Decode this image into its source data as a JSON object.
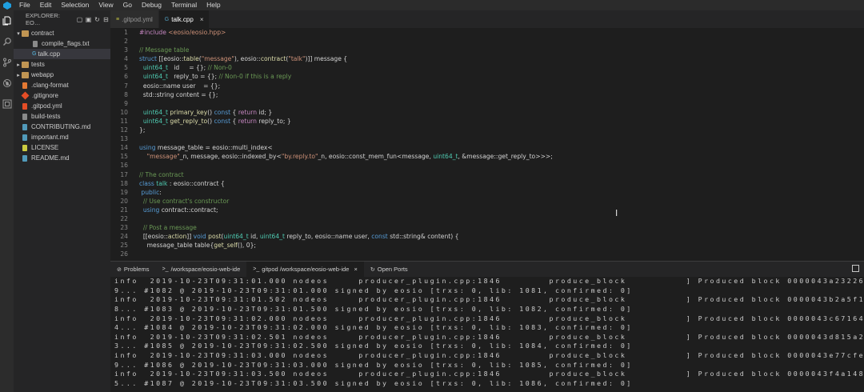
{
  "menubar": {
    "items": [
      "File",
      "Edit",
      "Selection",
      "View",
      "Go",
      "Debug",
      "Terminal",
      "Help"
    ]
  },
  "activity_bar": {
    "icons": [
      "files-icon",
      "search-icon",
      "source-control-icon",
      "debug-icon",
      "extensions-icon"
    ]
  },
  "sidebar": {
    "title": "EXPLORER: EO…",
    "tree": [
      {
        "label": "contract",
        "kind": "folder",
        "open": true,
        "level": 0
      },
      {
        "label": "compile_flags.txt",
        "kind": "file",
        "level": 1
      },
      {
        "label": "talk.cpp",
        "kind": "cpp",
        "level": 1,
        "selected": true
      },
      {
        "label": "tests",
        "kind": "folder",
        "open": false,
        "level": 0
      },
      {
        "label": "webapp",
        "kind": "folder",
        "open": false,
        "level": 0
      },
      {
        "label": ".clang-format",
        "kind": "fmt",
        "level": 0
      },
      {
        "label": ".gitignore",
        "kind": "git",
        "level": 0
      },
      {
        "label": ".gitpod.yml",
        "kind": "yml",
        "level": 0
      },
      {
        "label": "build-tests",
        "kind": "file",
        "level": 0
      },
      {
        "label": "CONTRIBUTING.md",
        "kind": "md",
        "level": 0
      },
      {
        "label": "important.md",
        "kind": "md",
        "level": 0
      },
      {
        "label": "LICENSE",
        "kind": "lic",
        "level": 0
      },
      {
        "label": "README.md",
        "kind": "md",
        "level": 0
      }
    ]
  },
  "tabs": [
    {
      "label": ".gitpod.yml",
      "active": false,
      "icon_text": "≡"
    },
    {
      "label": "talk.cpp",
      "active": true,
      "icon_text": "G"
    }
  ],
  "editor": {
    "lines": [
      {
        "n": "1",
        "tokens": [
          [
            "pp",
            "#include"
          ],
          [
            "str",
            " <eosio/eosio.hpp>"
          ]
        ]
      },
      {
        "n": "2",
        "tokens": []
      },
      {
        "n": "3",
        "tokens": [
          [
            "cm",
            "// Message table"
          ]
        ]
      },
      {
        "n": "4",
        "tokens": [
          [
            "kw",
            "struct"
          ],
          [
            "code",
            " [["
          ],
          [
            "ns",
            "eosio"
          ],
          [
            "code",
            "::"
          ],
          [
            "fn",
            "table"
          ],
          [
            "code",
            "("
          ],
          [
            "str",
            "\"message\""
          ],
          [
            "code",
            "), "
          ],
          [
            "ns",
            "eosio"
          ],
          [
            "code",
            "::"
          ],
          [
            "fn",
            "contract"
          ],
          [
            "code",
            "("
          ],
          [
            "str",
            "\"talk\""
          ],
          [
            "code",
            ")]] message {"
          ]
        ]
      },
      {
        "n": "5",
        "tokens": [
          [
            "code",
            "  "
          ],
          [
            "ty",
            "uint64_t"
          ],
          [
            "code",
            "   id     = {}; "
          ],
          [
            "cm",
            "// Non-0"
          ]
        ]
      },
      {
        "n": "6",
        "tokens": [
          [
            "code",
            "  "
          ],
          [
            "ty",
            "uint64_t"
          ],
          [
            "code",
            "   reply_to = {}; "
          ],
          [
            "cm",
            "// Non-0 if this is a reply"
          ]
        ]
      },
      {
        "n": "7",
        "tokens": [
          [
            "code",
            "  eosio::name user    = {};"
          ]
        ]
      },
      {
        "n": "8",
        "tokens": [
          [
            "code",
            "  std::string content = {};"
          ]
        ]
      },
      {
        "n": "9",
        "tokens": []
      },
      {
        "n": "10",
        "tokens": [
          [
            "code",
            "  "
          ],
          [
            "ty",
            "uint64_t"
          ],
          [
            "code",
            " "
          ],
          [
            "fn",
            "primary_key"
          ],
          [
            "code",
            "() "
          ],
          [
            "kw",
            "const"
          ],
          [
            "code",
            " { "
          ],
          [
            "pp",
            "return"
          ],
          [
            "code",
            " id; }"
          ]
        ]
      },
      {
        "n": "11",
        "tokens": [
          [
            "code",
            "  "
          ],
          [
            "ty",
            "uint64_t"
          ],
          [
            "code",
            " "
          ],
          [
            "fn",
            "get_reply_to"
          ],
          [
            "code",
            "() "
          ],
          [
            "kw",
            "const"
          ],
          [
            "code",
            " { "
          ],
          [
            "pp",
            "return"
          ],
          [
            "code",
            " reply_to; }"
          ]
        ]
      },
      {
        "n": "12",
        "tokens": [
          [
            "code",
            "};"
          ]
        ]
      },
      {
        "n": "13",
        "tokens": []
      },
      {
        "n": "14",
        "tokens": [
          [
            "kw",
            "using"
          ],
          [
            "code",
            " message_table = eosio::multi_index<"
          ]
        ]
      },
      {
        "n": "15",
        "tokens": [
          [
            "code",
            "    "
          ],
          [
            "str",
            "\"message\""
          ],
          [
            "code",
            "_n, message, eosio::indexed_by<"
          ],
          [
            "str",
            "\"by.reply.to\""
          ],
          [
            "code",
            "_n, eosio::const_mem_fun<message, "
          ],
          [
            "ty",
            "uint64_t"
          ],
          [
            "code",
            ", &message::get_reply_to>>>;"
          ]
        ]
      },
      {
        "n": "16",
        "tokens": []
      },
      {
        "n": "17",
        "tokens": [
          [
            "cm",
            "// The contract"
          ]
        ]
      },
      {
        "n": "18",
        "tokens": [
          [
            "kw",
            "class"
          ],
          [
            "code",
            " "
          ],
          [
            "ty",
            "talk"
          ],
          [
            "code",
            " : eosio::contract {"
          ]
        ]
      },
      {
        "n": "19",
        "tokens": [
          [
            "code",
            " "
          ],
          [
            "kw",
            "public"
          ],
          [
            "code",
            ":"
          ]
        ]
      },
      {
        "n": "20",
        "tokens": [
          [
            "code",
            "  "
          ],
          [
            "cm",
            "// Use contract's constructor"
          ]
        ]
      },
      {
        "n": "21",
        "tokens": [
          [
            "code",
            "  "
          ],
          [
            "kw",
            "using"
          ],
          [
            "code",
            " contract::contract;"
          ]
        ]
      },
      {
        "n": "22",
        "tokens": []
      },
      {
        "n": "23",
        "tokens": [
          [
            "code",
            "  "
          ],
          [
            "cm",
            "// Post a message"
          ]
        ]
      },
      {
        "n": "24",
        "tokens": [
          [
            "code",
            "  [["
          ],
          [
            "ns",
            "eosio"
          ],
          [
            "code",
            "::"
          ],
          [
            "fn",
            "action"
          ],
          [
            "code",
            "]] "
          ],
          [
            "kw",
            "void"
          ],
          [
            "code",
            " "
          ],
          [
            "fn",
            "post"
          ],
          [
            "code",
            "("
          ],
          [
            "ty",
            "uint64_t"
          ],
          [
            "code",
            " id, "
          ],
          [
            "ty",
            "uint64_t"
          ],
          [
            "code",
            " reply_to, eosio::name user, "
          ],
          [
            "kw",
            "const"
          ],
          [
            "code",
            " std::string& content) {"
          ]
        ]
      },
      {
        "n": "25",
        "tokens": [
          [
            "code",
            "    message_table table{"
          ],
          [
            "fn",
            "get_self"
          ],
          [
            "code",
            "(), 0};"
          ]
        ]
      },
      {
        "n": "26",
        "tokens": []
      }
    ]
  },
  "panel": {
    "tabs": [
      {
        "label": "Problems",
        "icon": "⊘"
      },
      {
        "label": "/workspace/eosio-web-ide",
        "icon": ">_"
      },
      {
        "label": "gitpod /workspace/eosio-web-ide",
        "icon": ">_",
        "active": true,
        "closable": true
      },
      {
        "label": "Open Ports",
        "icon": "↻"
      }
    ],
    "terminal_lines": [
      "info  2019-10-23T09:31:01.000 nodeos     producer_plugin.cpp:1846        produce_block          ] Produced block 0000043a23226e9",
      "9... #1082 @ 2019-10-23T09:31:01.000 signed by eosio [trxs: 0, lib: 1081, confirmed: 0]",
      "info  2019-10-23T09:31:01.502 nodeos     producer_plugin.cpp:1846        produce_block          ] Produced block 0000043b2a5f155",
      "8... #1083 @ 2019-10-23T09:31:01.500 signed by eosio [trxs: 0, lib: 1082, confirmed: 0]",
      "info  2019-10-23T09:31:02.000 nodeos     producer_plugin.cpp:1846        produce_block          ] Produced block 0000043c6716474",
      "4... #1084 @ 2019-10-23T09:31:02.000 signed by eosio [trxs: 0, lib: 1083, confirmed: 0]",
      "info  2019-10-23T09:31:02.501 nodeos     producer_plugin.cpp:1846        produce_block          ] Produced block 0000043d815a256",
      "3... #1085 @ 2019-10-23T09:31:02.500 signed by eosio [trxs: 0, lib: 1084, confirmed: 0]",
      "info  2019-10-23T09:31:03.000 nodeos     producer_plugin.cpp:1846        produce_block          ] Produced block 0000043e77cfe91",
      "9... #1086 @ 2019-10-23T09:31:03.000 signed by eosio [trxs: 0, lib: 1085, confirmed: 0]",
      "info  2019-10-23T09:31:03.500 nodeos     producer_plugin.cpp:1846        produce_block          ] Produced block 0000043f4a148c9",
      "5... #1087 @ 2019-10-23T09:31:03.500 signed by eosio [trxs: 0, lib: 1086, confirmed: 0]"
    ]
  }
}
